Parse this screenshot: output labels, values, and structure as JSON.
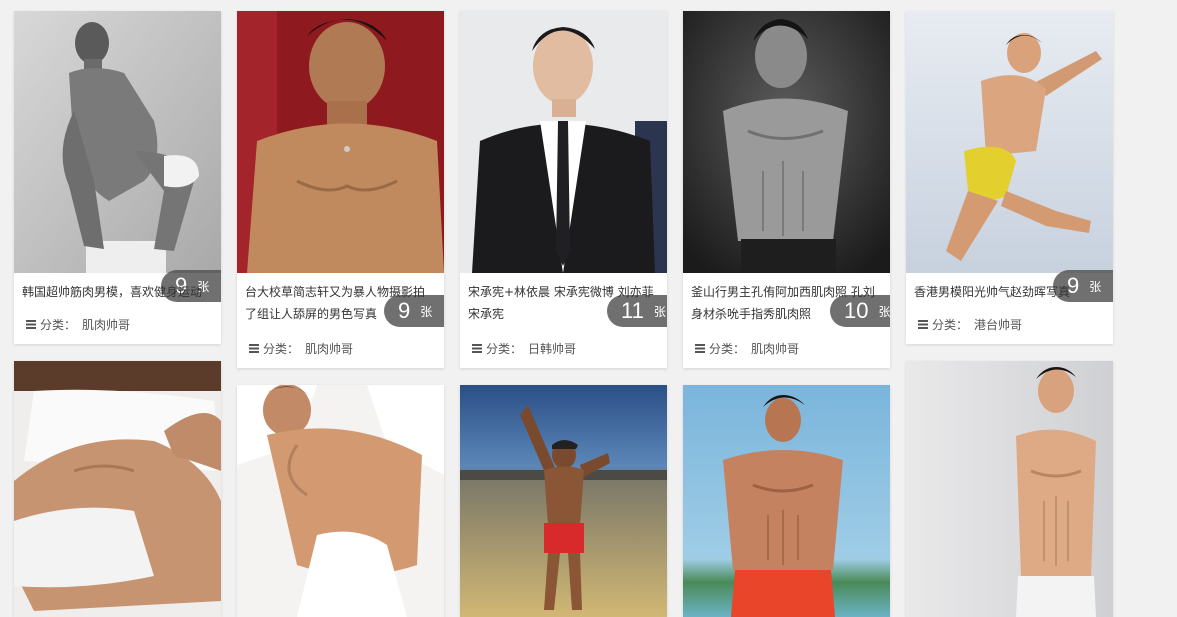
{
  "gallery": {
    "unit_label": "张",
    "category_prefix": "分类：",
    "cards": [
      {
        "caption": "韩国超帅筋肉男模，喜欢健身运动",
        "count": "9",
        "category": "肌肉帅哥",
        "photo": "muscular-man-crouching-photo"
      },
      {
        "caption": "台大校草简志轩又为暴人物摄影拍了组让人舔屏的男色写真",
        "count": "9",
        "category": "肌肉帅哥",
        "photo": "shirtless-man-red-background-photo"
      },
      {
        "caption": "宋承宪+林依晨 宋承宪微博 刘亦菲宋承宪",
        "count": "11",
        "category": "日韩帅哥",
        "photo": "man-in-black-suit-photo"
      },
      {
        "caption": "釜山行男主孔侑阿加西肌肉照 孔刘身材杀吮手指秀肌肉照",
        "count": "10",
        "category": "肌肉帅哥",
        "photo": "shirtless-man-bw-photo"
      },
      {
        "caption": "香港男模阳光帅气赵劲晖写真",
        "count": "9",
        "category": "港台帅哥",
        "photo": "man-jumping-sky-photo"
      },
      {
        "caption": "",
        "count": "",
        "category": "",
        "photo": "man-lying-bed-photo"
      },
      {
        "caption": "",
        "count": "",
        "category": "",
        "photo": "man-on-white-pillows-photo"
      },
      {
        "caption": "",
        "count": "",
        "category": "",
        "photo": "man-posing-rooftop-photo"
      },
      {
        "caption": "",
        "count": "",
        "category": "",
        "photo": "man-red-shorts-beach-photo"
      },
      {
        "caption": "",
        "count": "",
        "category": "",
        "photo": "man-leaning-wall-photo"
      }
    ]
  }
}
